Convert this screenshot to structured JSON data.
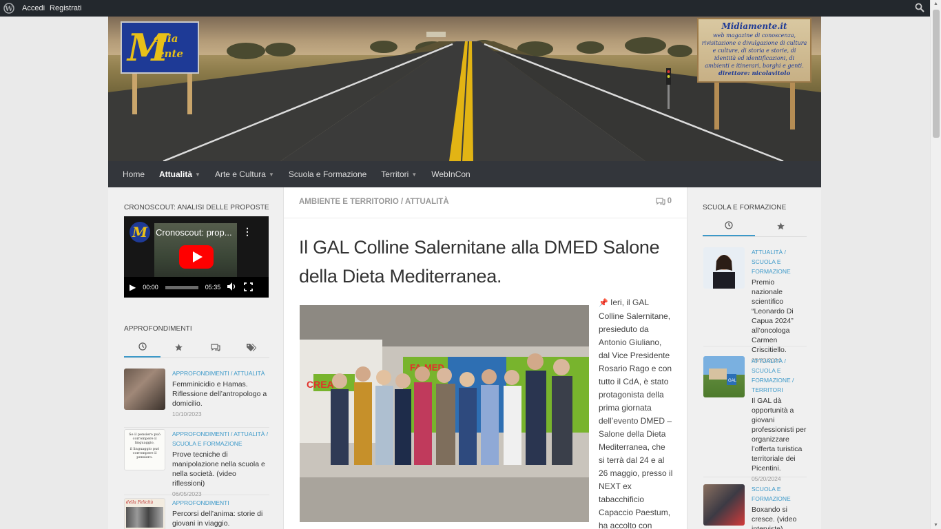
{
  "adminbar": {
    "login": "Accedi",
    "register": "Registrati",
    "icons": [
      "wordpress-icon",
      "search-icon"
    ]
  },
  "header": {
    "logo_letter": "M",
    "logo_top": "edia",
    "logo_bottom": "ente",
    "board_title": "Midiamente.it",
    "board_subtitle": "web magazine di conoscenza, rivisitazione e divulgazione di cultura e culture, di storia e storie, di identità ed identificazioni, di ambienti e itinerari, borghi e genti.",
    "board_director": "direttore: nicolavitolo"
  },
  "nav": {
    "items": [
      {
        "label": "Home",
        "dropdown": false,
        "active": false
      },
      {
        "label": "Attualità",
        "dropdown": true,
        "active": true
      },
      {
        "label": "Arte e Cultura",
        "dropdown": true,
        "active": false
      },
      {
        "label": "Scuola e Formazione",
        "dropdown": false,
        "active": false
      },
      {
        "label": "Territori",
        "dropdown": true,
        "active": false
      },
      {
        "label": "WebInCon",
        "dropdown": false,
        "active": false
      }
    ]
  },
  "left": {
    "video_widget_title": "CRONOSCOUT: ANALISI DELLE PROPOSTE",
    "video": {
      "title": "Cronoscout: prop...",
      "current_time": "00:00",
      "duration": "05:35"
    },
    "posts_widget_title": "APPROFONDIMENTI",
    "posts": [
      {
        "cat": "APPROFONDIMENTI / ATTUALITÀ",
        "title": "Femminicidio e Hamas. Riflessione dell’antropologo a domicilio.",
        "date": "10/10/2023"
      },
      {
        "cat": "APPROFONDIMENTI / ATTUALITÀ / SCUOLA E FORMAZIONE",
        "title": "Prove tecniche di manipolazione nella scuola e nella società. (video riflessioni)",
        "date": "06/05/2023",
        "thumb_lines": [
          "Se il pensiero può corrompere il linguaggio,",
          "il linguaggio può corrompere il pensiero."
        ]
      },
      {
        "cat": "APPROFONDIMENTI",
        "title": "Percorsi dell’anima: storie di giovani in viaggio.",
        "thumb_label": "della Felicità"
      }
    ]
  },
  "main": {
    "category": "AMBIENTE E TERRITORIO / ATTUALITÀ",
    "comments": "0",
    "title": "Il GAL Colline Salernitane alla DMED Salone della Dieta Mediterranea.",
    "body": "Ieri, il GAL Colline Salernitane, presieduto da Antonio Giuliano, dal Vice Presidente Rosario Rago e con tutto il CdA, è stato protagonista della prima giornata dell’evento DMED – Salone della Dieta Mediterranea, che si terrà dal 24 e al 26 maggio, presso il NEXT ex tabacchificio Capaccio Paestum, ha accolto con",
    "photo_signs": [
      "CREA",
      "FA-MED"
    ]
  },
  "right": {
    "widget_title": "SCUOLA E FORMAZIONE",
    "posts": [
      {
        "cat": "ATTUALITÀ / SCUOLA E FORMAZIONE",
        "title": "Premio nazionale scientifico “Leonardo Di Capua 2024” all’oncologa Carmen Criscitiello.",
        "date": "05/23/2024"
      },
      {
        "cat": "ATTUALITÀ / SCUOLA E FORMAZIONE / TERRITORI",
        "title": "Il GAL dà opportunità a giovani professionisti per organizzare l’offerta turistica territoriale dei Picentini.",
        "date": "05/20/2024"
      },
      {
        "cat": "SCUOLA E FORMAZIONE",
        "title": "Boxando si cresce. (video interviste)"
      }
    ]
  },
  "colors": {
    "accent": "#3c99c9",
    "nav_bg": "#33363b",
    "adminbar_bg": "#23282d"
  }
}
